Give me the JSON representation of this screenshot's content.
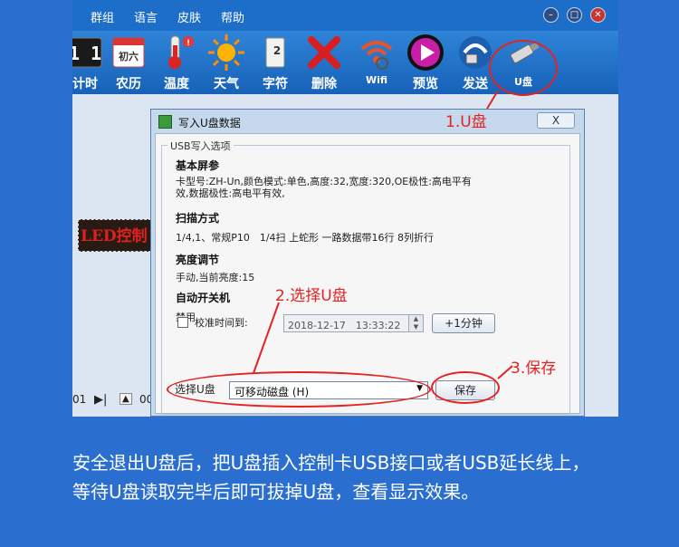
{
  "menu": [
    "群组",
    "语言",
    "皮肤",
    "帮助"
  ],
  "window_controls": [
    "minimize",
    "maximize",
    "close"
  ],
  "toolbar": [
    {
      "label": "计时",
      "icon": "clock-icon"
    },
    {
      "label": "农历",
      "icon": "calendar-icon",
      "icon_text": "初六"
    },
    {
      "label": "温度",
      "icon": "thermometer-icon"
    },
    {
      "label": "天气",
      "icon": "sun-icon"
    },
    {
      "label": "字符",
      "icon": "character-icon"
    },
    {
      "label": "删除",
      "icon": "delete-icon"
    },
    {
      "label": "Wifi",
      "icon": "wifi-icon"
    },
    {
      "label": "预览",
      "icon": "play-icon"
    },
    {
      "label": "发送",
      "icon": "send-icon"
    },
    {
      "label": "U盘",
      "icon": "usb-drive-icon"
    }
  ],
  "led_preview_text": "LED控制",
  "bottom_controls": {
    "left_number": "01",
    "right_number": "00"
  },
  "dialog": {
    "title": "写入U盘数据",
    "close_label": "X",
    "group_title": "USB写入选项",
    "basic_heading": "基本屏参",
    "basic_text": "卡型号:ZH-Un,颜色模式:单色,高度:32,宽度:320,OE极性:高电平有效,数据极性:高电平有效,",
    "scan_heading": "扫描方式",
    "scan_text": "1/4,1、常规P10　1/4扫 上蛇形 一路数据带16行 8列折行",
    "brightness_heading": "亮度调节",
    "brightness_text": "手动,当前亮度:15",
    "power_heading": "自动开关机",
    "power_text": "禁用",
    "calibrate_label": "校准时间到:",
    "datetime_value": "2018-12-17　13:33:22",
    "plus_minute_label": "+1分钟",
    "select_disk_label": "选择U盘",
    "disk_value": "可移动磁盘 (H)",
    "save_label": "保存"
  },
  "annotations": {
    "step1": "1.U盘",
    "step2": "2.选择U盘",
    "step3": "3.保存"
  },
  "caption": {
    "line1": "安全退出U盘后，把U盘插入控制卡USB接口或者USB延长线上，",
    "line2": "等待U盘读取完毕后即可拔掉U盘，查看显示效果。"
  },
  "colors": {
    "background": "#2a6fd0",
    "toolbar": "#1d6ec9",
    "annotation": "#e52222",
    "led_text": "#e02020"
  }
}
